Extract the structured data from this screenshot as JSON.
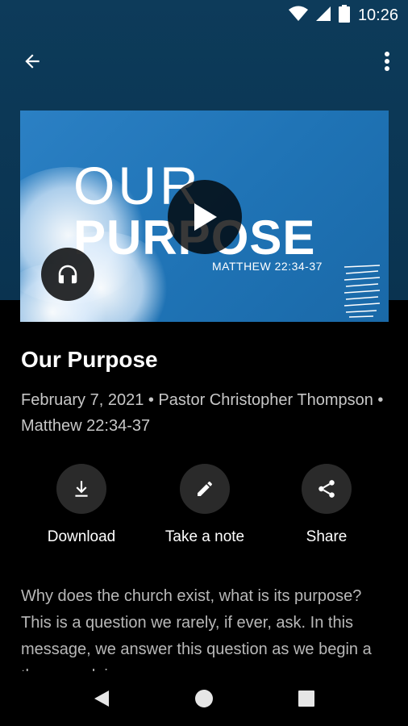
{
  "status_bar": {
    "time": "10:26",
    "icons": [
      "wifi-icon",
      "signal-icon",
      "battery-icon"
    ]
  },
  "toolbar": {
    "back_icon": "arrow-left-icon",
    "menu_icon": "more-vertical-icon"
  },
  "hero": {
    "line1": "OUR",
    "line2": "PURPOSE",
    "reference": "MATTHEW 22:34-37",
    "play_icon": "play-icon",
    "audio_icon": "headphones-icon"
  },
  "sermon": {
    "title": "Our Purpose",
    "meta": "February 7, 2021 • Pastor Christopher Thompson • Matthew 22:34-37",
    "description": "Why does the church exist, what is its purpose? This is a question we rarely, if ever, ask. In this message, we answer this question as we begin a three week journey"
  },
  "actions": [
    {
      "label": "Download",
      "icon": "download-icon"
    },
    {
      "label": "Take a note",
      "icon": "pencil-icon"
    },
    {
      "label": "Share",
      "icon": "share-icon"
    }
  ],
  "nav": {
    "back_icon": "triangle-back-icon",
    "home_icon": "circle-home-icon",
    "recents_icon": "square-recents-icon"
  },
  "colors": {
    "header_bg": "#0d3b5a",
    "artwork_bg": "#2078bb",
    "action_circle": "#2a2a2a",
    "meta_text": "#c7c7c7"
  }
}
